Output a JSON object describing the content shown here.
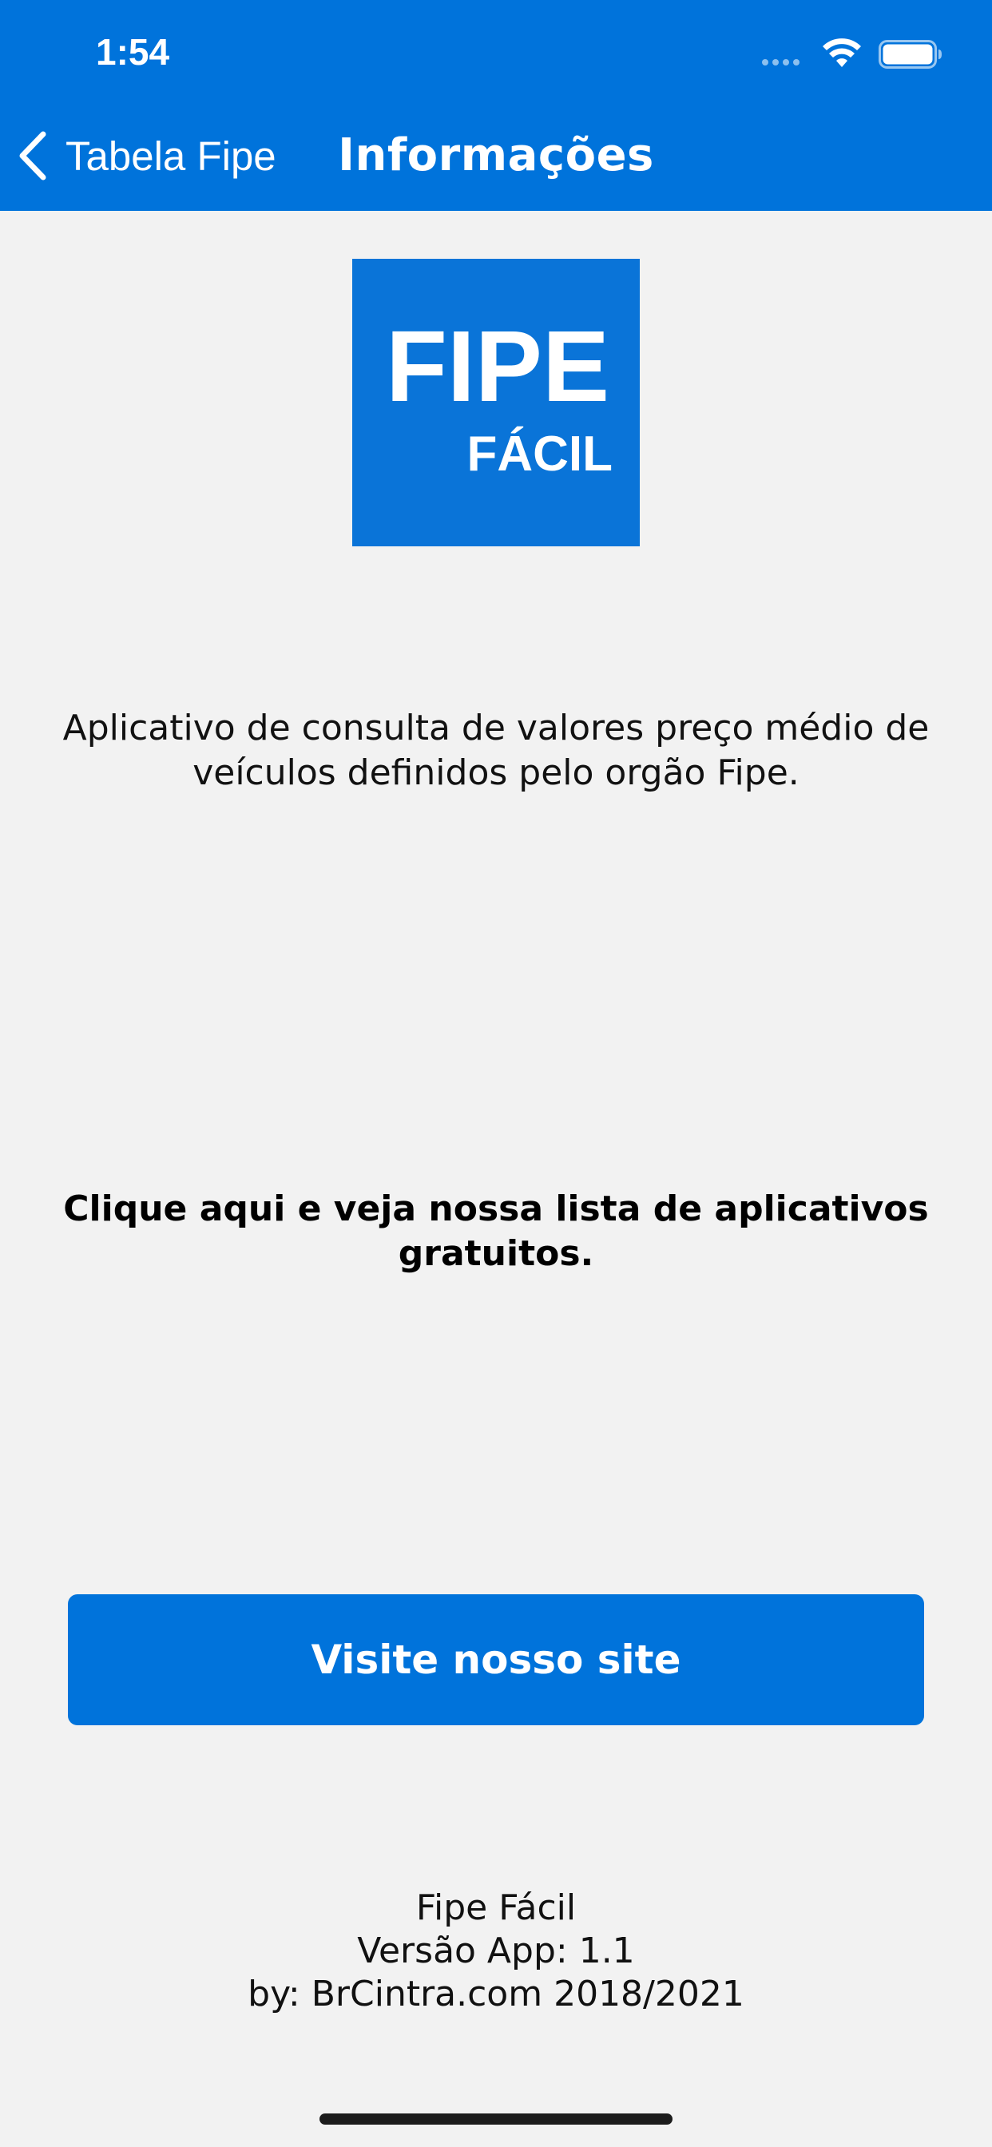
{
  "status_bar": {
    "time": "1:54",
    "icons": [
      "cellular-signal-icon",
      "wifi-icon",
      "battery-icon"
    ]
  },
  "nav": {
    "back_label": "Tabela Fipe",
    "title": "Informações"
  },
  "logo": {
    "line1": "FIPE",
    "line2": "FÁCIL"
  },
  "content": {
    "description": "Aplicativo de consulta de valores preço médio de veículos definidos pelo orgão Fipe.",
    "apps_link": "Clique aqui e veja nossa lista de aplicativos gratuitos.",
    "site_button": "Visite nosso site"
  },
  "footer": {
    "app_name": "Fipe Fácil",
    "version": "Versão App: 1.1",
    "credits": "by: BrCintra.com 2018/2021"
  },
  "colors": {
    "primary": "#0073db",
    "background": "#f2f2f2",
    "text": "#111111"
  }
}
